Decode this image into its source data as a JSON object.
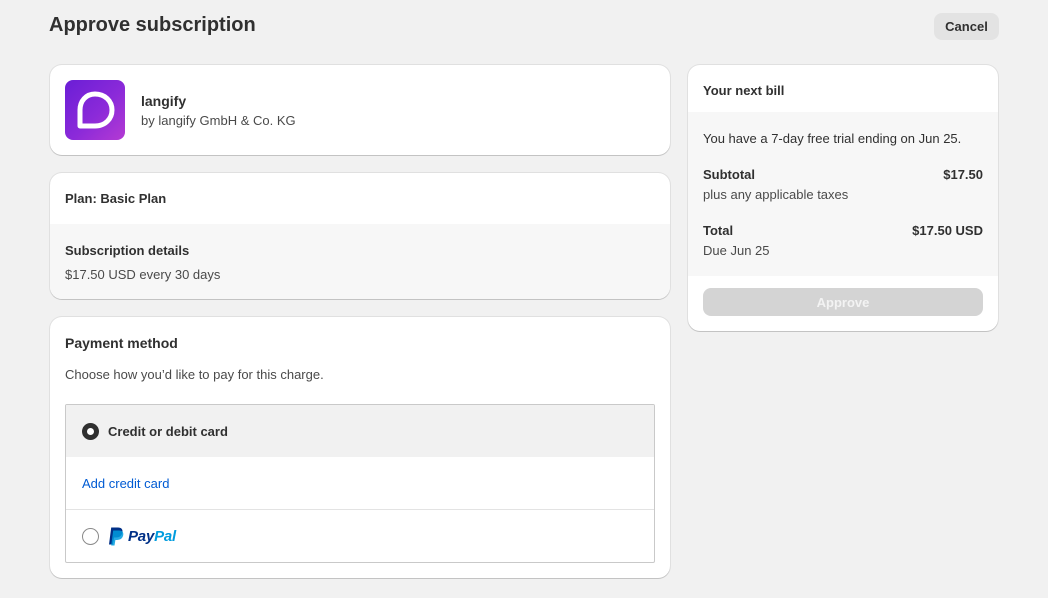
{
  "header": {
    "title": "Approve subscription",
    "cancel_label": "Cancel"
  },
  "app": {
    "name": "langify",
    "vendor": "by langify GmbH & Co. KG",
    "logo_icon": "langify-logo-icon",
    "logo_colors": [
      "#6a1ed6",
      "#b43ad3"
    ]
  },
  "plan": {
    "title": "Plan: Basic Plan",
    "details_title": "Subscription details",
    "details_price": "$17.50 USD every 30 days"
  },
  "payment": {
    "title": "Payment method",
    "subtitle": "Choose how you’d like to pay for this charge.",
    "options": [
      {
        "label": "Credit or debit card",
        "selected": true
      },
      {
        "label": "PayPal",
        "selected": false
      }
    ],
    "add_card_link": "Add credit card",
    "paypal_pay": "Pay",
    "paypal_pal": "Pal"
  },
  "bill": {
    "title": "Your next bill",
    "trial_text": "You have a 7-day free trial ending on Jun 25.",
    "subtotal_label": "Subtotal",
    "subtotal_value": "$17.50",
    "subtotal_note": "plus any applicable taxes",
    "total_label": "Total",
    "total_value": "$17.50 USD",
    "total_note": "Due Jun 25",
    "approve_label": "Approve",
    "approve_disabled": true
  },
  "colors": {
    "background": "#f1f1f1",
    "link": "#005bd3",
    "paypal_dark": "#003087",
    "paypal_light": "#009cde"
  }
}
